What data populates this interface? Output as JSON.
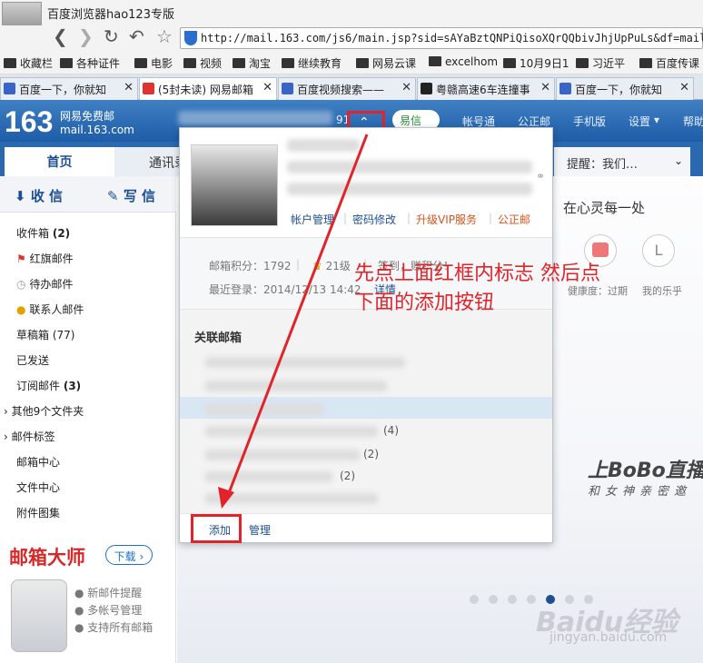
{
  "browser": {
    "title": "百度浏览器hao123专版",
    "url": "http://mail.163.com/js6/main.jsp?sid=sAYaBztQNPiQisoXQrQQbivJhjUpPuLs&df=mail16",
    "bookmarks": [
      "收藏栏",
      "各种证件",
      "电影",
      "视频",
      "淘宝",
      "继续教育",
      "网易云课",
      "excelhom",
      "10月9日1",
      "习近平",
      "百度传课"
    ],
    "tabs": [
      {
        "label": "百度一下，你就知",
        "active": false
      },
      {
        "label": "(5封未读) 网易邮箱",
        "active": true
      },
      {
        "label": "百度视频搜索——",
        "active": false
      },
      {
        "label": "粤赣高速6车连撞事",
        "active": false
      },
      {
        "label": "百度一下，你就知",
        "active": false
      }
    ]
  },
  "header": {
    "logo_num": "163",
    "logo_line1": "网易免费邮",
    "logo_line2": "mail.163.com",
    "account_suffix": "91",
    "yixin": "易信",
    "links": [
      "帐号通",
      "公正邮",
      "手机版",
      "设置",
      "帮助"
    ]
  },
  "navtabs": {
    "home": "首页",
    "contacts": "通讯录",
    "reminder": "提醒：我们…"
  },
  "sidebar": {
    "receive": "收 信",
    "write": "写 信",
    "items": [
      {
        "label": "收件箱",
        "count": "(2)"
      },
      {
        "label": "红旗邮件",
        "count": ""
      },
      {
        "label": "待办邮件",
        "count": ""
      },
      {
        "label": "联系人邮件",
        "count": ""
      },
      {
        "label": "草稿箱",
        "count": "(77)"
      },
      {
        "label": "已发送",
        "count": ""
      },
      {
        "label": "订阅邮件",
        "count": "(3)"
      },
      {
        "label": "其他9个文件夹",
        "count": ""
      },
      {
        "label": "邮件标签",
        "count": ""
      },
      {
        "label": "邮箱中心",
        "count": ""
      },
      {
        "label": "文件中心",
        "count": ""
      },
      {
        "label": "附件图集",
        "count": ""
      }
    ],
    "promo_title": "邮箱大师",
    "promo_download": "下载",
    "promo_features": [
      "新邮件提醒",
      "多帐号管理",
      "支持所有邮箱"
    ]
  },
  "dropdown": {
    "links": [
      "帐户管理",
      "密码修改",
      "升级VIP服务",
      "公正邮"
    ],
    "score_label": "邮箱积分：1792",
    "level": "21级",
    "sign": "签到，赚积分！",
    "last_login": "最近登录：2014/12/13 14:42",
    "detail": "详情",
    "related_title": "关联邮箱",
    "related_counts": [
      "(4)",
      "(2)",
      "(2)"
    ],
    "add": "添加",
    "manage": "管理"
  },
  "content": {
    "tagline": "在心灵每一处",
    "circles_labels": [
      "健康度：过期",
      "我的乐乎"
    ],
    "bobo": "上BoBo直播",
    "bobo_sub": "和女神亲密邀",
    "slides_active_index": 4,
    "slides_count": 7
  },
  "annotation": {
    "line1": "先点上面红框内标志 然后点",
    "line2": "下面的添加按钮"
  },
  "watermark": {
    "main": "Baidu经验",
    "sub": "jingyan.baidu.com"
  },
  "colors": {
    "accent": "#1d4f93",
    "red": "#e0242a",
    "header": "#2a68b0"
  }
}
